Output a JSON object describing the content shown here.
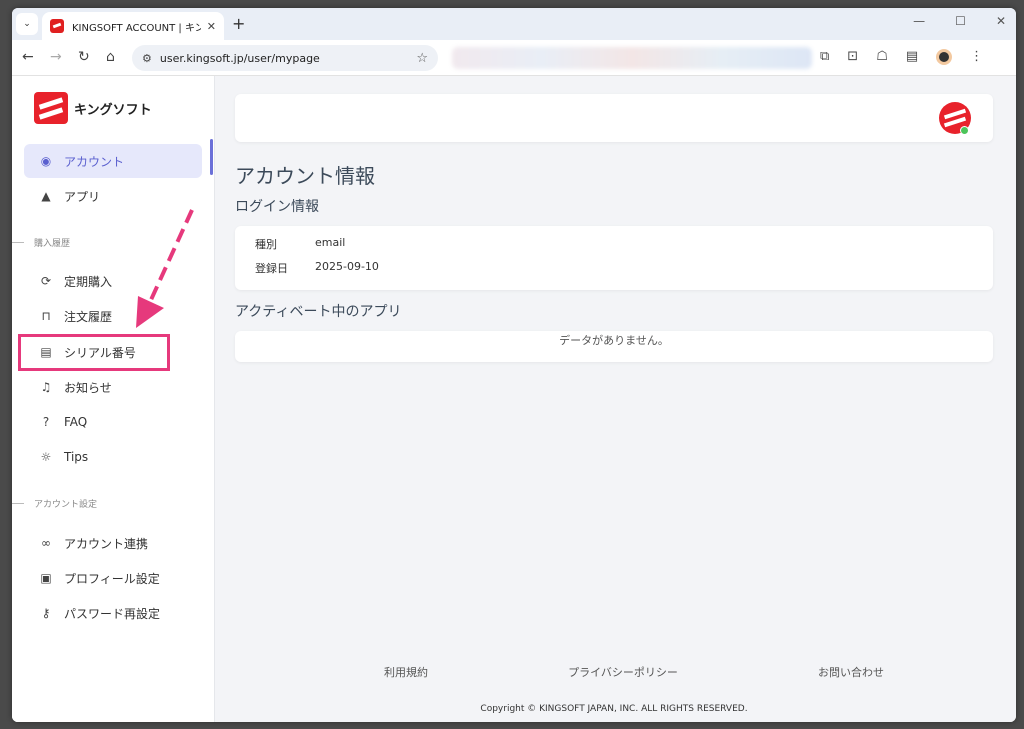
{
  "browser": {
    "tab_title": "KINGSOFT ACCOUNT | キングソフ",
    "url": "user.kingsoft.jp/user/mypage"
  },
  "sidebar": {
    "brand": "キングソフト",
    "items_top": [
      {
        "label": "アカウント",
        "icon": "user-circle-icon"
      },
      {
        "label": "アプリ",
        "icon": "apps-icon"
      }
    ],
    "section_purchase": "購入履歴",
    "items_purchase": [
      {
        "label": "定期購入",
        "icon": "sync-icon"
      },
      {
        "label": "注文履歴",
        "icon": "bag-icon"
      },
      {
        "label": "シリアル番号",
        "icon": "document-icon"
      },
      {
        "label": "お知らせ",
        "icon": "bell-icon"
      },
      {
        "label": "FAQ",
        "icon": "question-icon"
      },
      {
        "label": "Tips",
        "icon": "lightbulb-icon"
      }
    ],
    "section_account": "アカウント設定",
    "items_account": [
      {
        "label": "アカウント連携",
        "icon": "link-icon"
      },
      {
        "label": "プロフィール設定",
        "icon": "profile-icon"
      },
      {
        "label": "パスワード再設定",
        "icon": "key-icon"
      }
    ]
  },
  "main": {
    "title": "アカウント情報",
    "login_section": "ログイン情報",
    "login_rows": [
      {
        "key": "種別",
        "value": "email"
      },
      {
        "key": "登録日",
        "value": "2025-09-10"
      }
    ],
    "apps_section": "アクティベート中のアプリ",
    "apps_empty": "データがありません。"
  },
  "footer": {
    "links": [
      "利用規約",
      "プライバシーポリシー",
      "お問い合わせ"
    ],
    "copyright": "Copyright © KINGSOFT JAPAN, INC. ALL RIGHTS RESERVED."
  },
  "colors": {
    "accent": "#5a5fcf",
    "brand": "#e8222b",
    "highlight": "#e6397c"
  }
}
